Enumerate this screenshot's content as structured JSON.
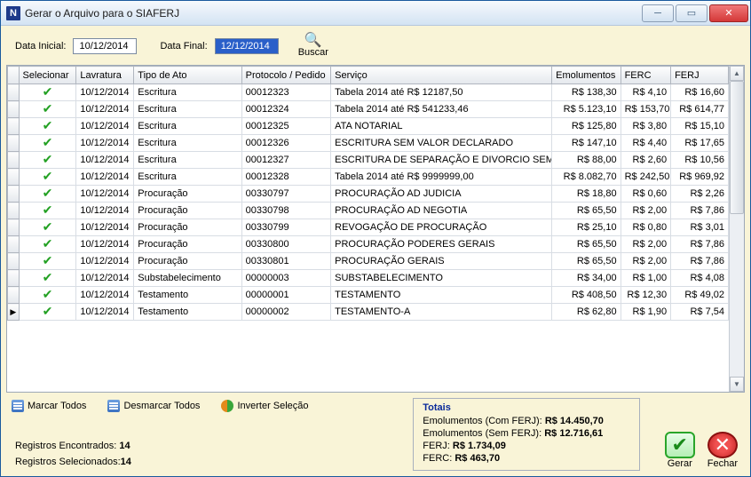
{
  "window": {
    "title": "Gerar o Arquivo para o SIAFERJ",
    "icon_letter": "N"
  },
  "search": {
    "data_inicial_label": "Data Inicial:",
    "data_inicial_value": "10/12/2014",
    "data_final_label": "Data Final:",
    "data_final_value": "12/12/2014",
    "buscar_label": "Buscar"
  },
  "columns": {
    "selecionar": "Selecionar",
    "lavratura": "Lavratura",
    "tipo": "Tipo de Ato",
    "protocolo": "Protocolo / Pedido",
    "servico": "Serviço",
    "emolumentos": "Emolumentos",
    "ferc": "FERC",
    "ferj": "FERJ"
  },
  "rows": [
    {
      "sel": true,
      "lav": "10/12/2014",
      "tipo": "Escritura",
      "prot": "00012323",
      "serv": "Tabela 2014 até R$ 12187,50",
      "emo": "R$ 138,30",
      "ferc": "R$ 4,10",
      "ferj": "R$ 16,60"
    },
    {
      "sel": true,
      "lav": "10/12/2014",
      "tipo": "Escritura",
      "prot": "00012324",
      "serv": "Tabela 2014 até R$ 541233,46",
      "emo": "R$ 5.123,10",
      "ferc": "R$ 153,70",
      "ferj": "R$ 614,77"
    },
    {
      "sel": true,
      "lav": "10/12/2014",
      "tipo": "Escritura",
      "prot": "00012325",
      "serv": "ATA NOTARIAL",
      "emo": "R$ 125,80",
      "ferc": "R$ 3,80",
      "ferj": "R$ 15,10"
    },
    {
      "sel": true,
      "lav": "10/12/2014",
      "tipo": "Escritura",
      "prot": "00012326",
      "serv": "ESCRITURA SEM VALOR DECLARADO",
      "emo": "R$ 147,10",
      "ferc": "R$ 4,40",
      "ferj": "R$ 17,65"
    },
    {
      "sel": true,
      "lav": "10/12/2014",
      "tipo": "Escritura",
      "prot": "00012327",
      "serv": "ESCRITURA DE SEPARAÇÃO E DIVORCIO SEM",
      "emo": "R$ 88,00",
      "ferc": "R$ 2,60",
      "ferj": "R$ 10,56"
    },
    {
      "sel": true,
      "lav": "10/12/2014",
      "tipo": "Escritura",
      "prot": "00012328",
      "serv": "Tabela 2014 até R$ 9999999,00",
      "emo": "R$ 8.082,70",
      "ferc": "R$ 242,50",
      "ferj": "R$ 969,92"
    },
    {
      "sel": true,
      "lav": "10/12/2014",
      "tipo": "Procuração",
      "prot": "00330797",
      "serv": "PROCURAÇÃO AD JUDICIA",
      "emo": "R$ 18,80",
      "ferc": "R$ 0,60",
      "ferj": "R$ 2,26"
    },
    {
      "sel": true,
      "lav": "10/12/2014",
      "tipo": "Procuração",
      "prot": "00330798",
      "serv": "PROCURAÇÃO AD NEGOTIA",
      "emo": "R$ 65,50",
      "ferc": "R$ 2,00",
      "ferj": "R$ 7,86"
    },
    {
      "sel": true,
      "lav": "10/12/2014",
      "tipo": "Procuração",
      "prot": "00330799",
      "serv": "REVOGAÇÃO DE PROCURAÇÃO",
      "emo": "R$ 25,10",
      "ferc": "R$ 0,80",
      "ferj": "R$ 3,01"
    },
    {
      "sel": true,
      "lav": "10/12/2014",
      "tipo": "Procuração",
      "prot": "00330800",
      "serv": "PROCURAÇÃO PODERES GERAIS",
      "emo": "R$ 65,50",
      "ferc": "R$ 2,00",
      "ferj": "R$ 7,86"
    },
    {
      "sel": true,
      "lav": "10/12/2014",
      "tipo": "Procuração",
      "prot": "00330801",
      "serv": "PROCURAÇÃO GERAIS",
      "emo": "R$ 65,50",
      "ferc": "R$ 2,00",
      "ferj": "R$ 7,86"
    },
    {
      "sel": true,
      "lav": "10/12/2014",
      "tipo": "Substabelecimento",
      "prot": "00000003",
      "serv": "SUBSTABELECIMENTO",
      "emo": "R$ 34,00",
      "ferc": "R$ 1,00",
      "ferj": "R$ 4,08"
    },
    {
      "sel": true,
      "lav": "10/12/2014",
      "tipo": "Testamento",
      "prot": "00000001",
      "serv": "TESTAMENTO",
      "emo": "R$ 408,50",
      "ferc": "R$ 12,30",
      "ferj": "R$ 49,02"
    },
    {
      "sel": true,
      "lav": "10/12/2014",
      "tipo": "Testamento",
      "prot": "00000002",
      "serv": "TESTAMENTO-A",
      "emo": "R$ 62,80",
      "ferc": "R$ 1,90",
      "ferj": "R$ 7,54",
      "current": true
    }
  ],
  "selbar": {
    "marcar": "Marcar Todos",
    "desmarcar": "Desmarcar Todos",
    "inverter": "Inverter Seleção"
  },
  "counts": {
    "encontrados_label": "Registros Encontrados:",
    "encontrados_value": "14",
    "selecionados_label": "Registros Selecionados:",
    "selecionados_value": "14"
  },
  "totals": {
    "header": "Totais",
    "l1_label": "Emolumentos (Com FERJ):",
    "l1_value": "R$ 14.450,70",
    "l2_label": "Emolumentos (Sem FERJ):",
    "l2_value": "R$ 12.716,61",
    "l3_label": "FERJ:",
    "l3_value": "R$ 1.734,09",
    "l4_label": "FERC:",
    "l4_value": "R$ 463,70"
  },
  "actions": {
    "gerar": "Gerar",
    "fechar": "Fechar"
  }
}
